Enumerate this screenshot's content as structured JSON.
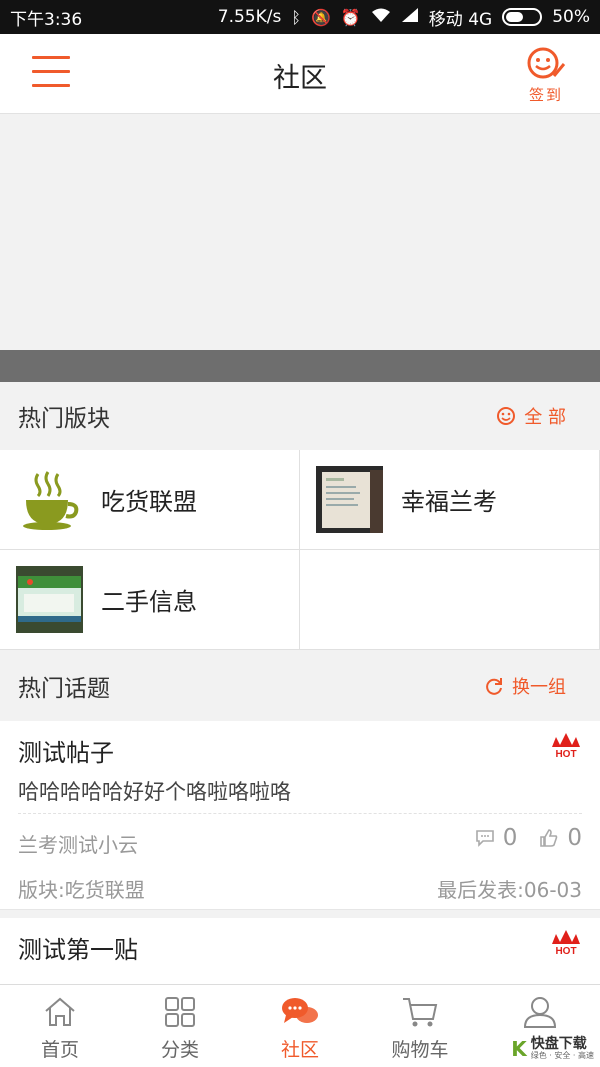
{
  "status_bar": {
    "time": "下午3:36",
    "speed": "7.55K/s",
    "carrier": "移动 4G",
    "battery": "50%"
  },
  "nav": {
    "title": "社区",
    "signin_label": "签到"
  },
  "hot_forums": {
    "title": "热门版块",
    "action_label": "全 部",
    "items": [
      {
        "name": "吃货联盟",
        "icon": "coffee-cup-icon"
      },
      {
        "name": "幸福兰考",
        "icon": "photo-thumbnail"
      },
      {
        "name": "二手信息",
        "icon": "photo-thumbnail"
      }
    ]
  },
  "hot_topics": {
    "title": "热门话题",
    "action_label": "换一组",
    "posts": [
      {
        "title": "测试帖子",
        "excerpt": "哈哈哈哈哈好好个咯啦咯啦咯",
        "author": "兰考测试小云",
        "comments": "0",
        "likes": "0",
        "forum": "版块:吃货联盟",
        "last_post": "最后发表:06-03",
        "badge": "HOT"
      },
      {
        "title": "测试第一贴",
        "badge": "HOT"
      }
    ]
  },
  "tabbar": {
    "items": [
      {
        "label": "首页",
        "icon": "home-icon"
      },
      {
        "label": "分类",
        "icon": "grid-icon"
      },
      {
        "label": "社区",
        "icon": "chat-bubbles-icon"
      },
      {
        "label": "购物车",
        "icon": "cart-icon"
      },
      {
        "label": "我的",
        "icon": "user-icon"
      }
    ],
    "active": "社区"
  },
  "colors": {
    "accent": "#f05a2b",
    "status_bar": "#121212",
    "banner_bar": "#6e6e6e"
  },
  "watermark": {
    "logo": "K",
    "text": "快盘下载",
    "sub": "绿色 · 安全 · 高速"
  }
}
